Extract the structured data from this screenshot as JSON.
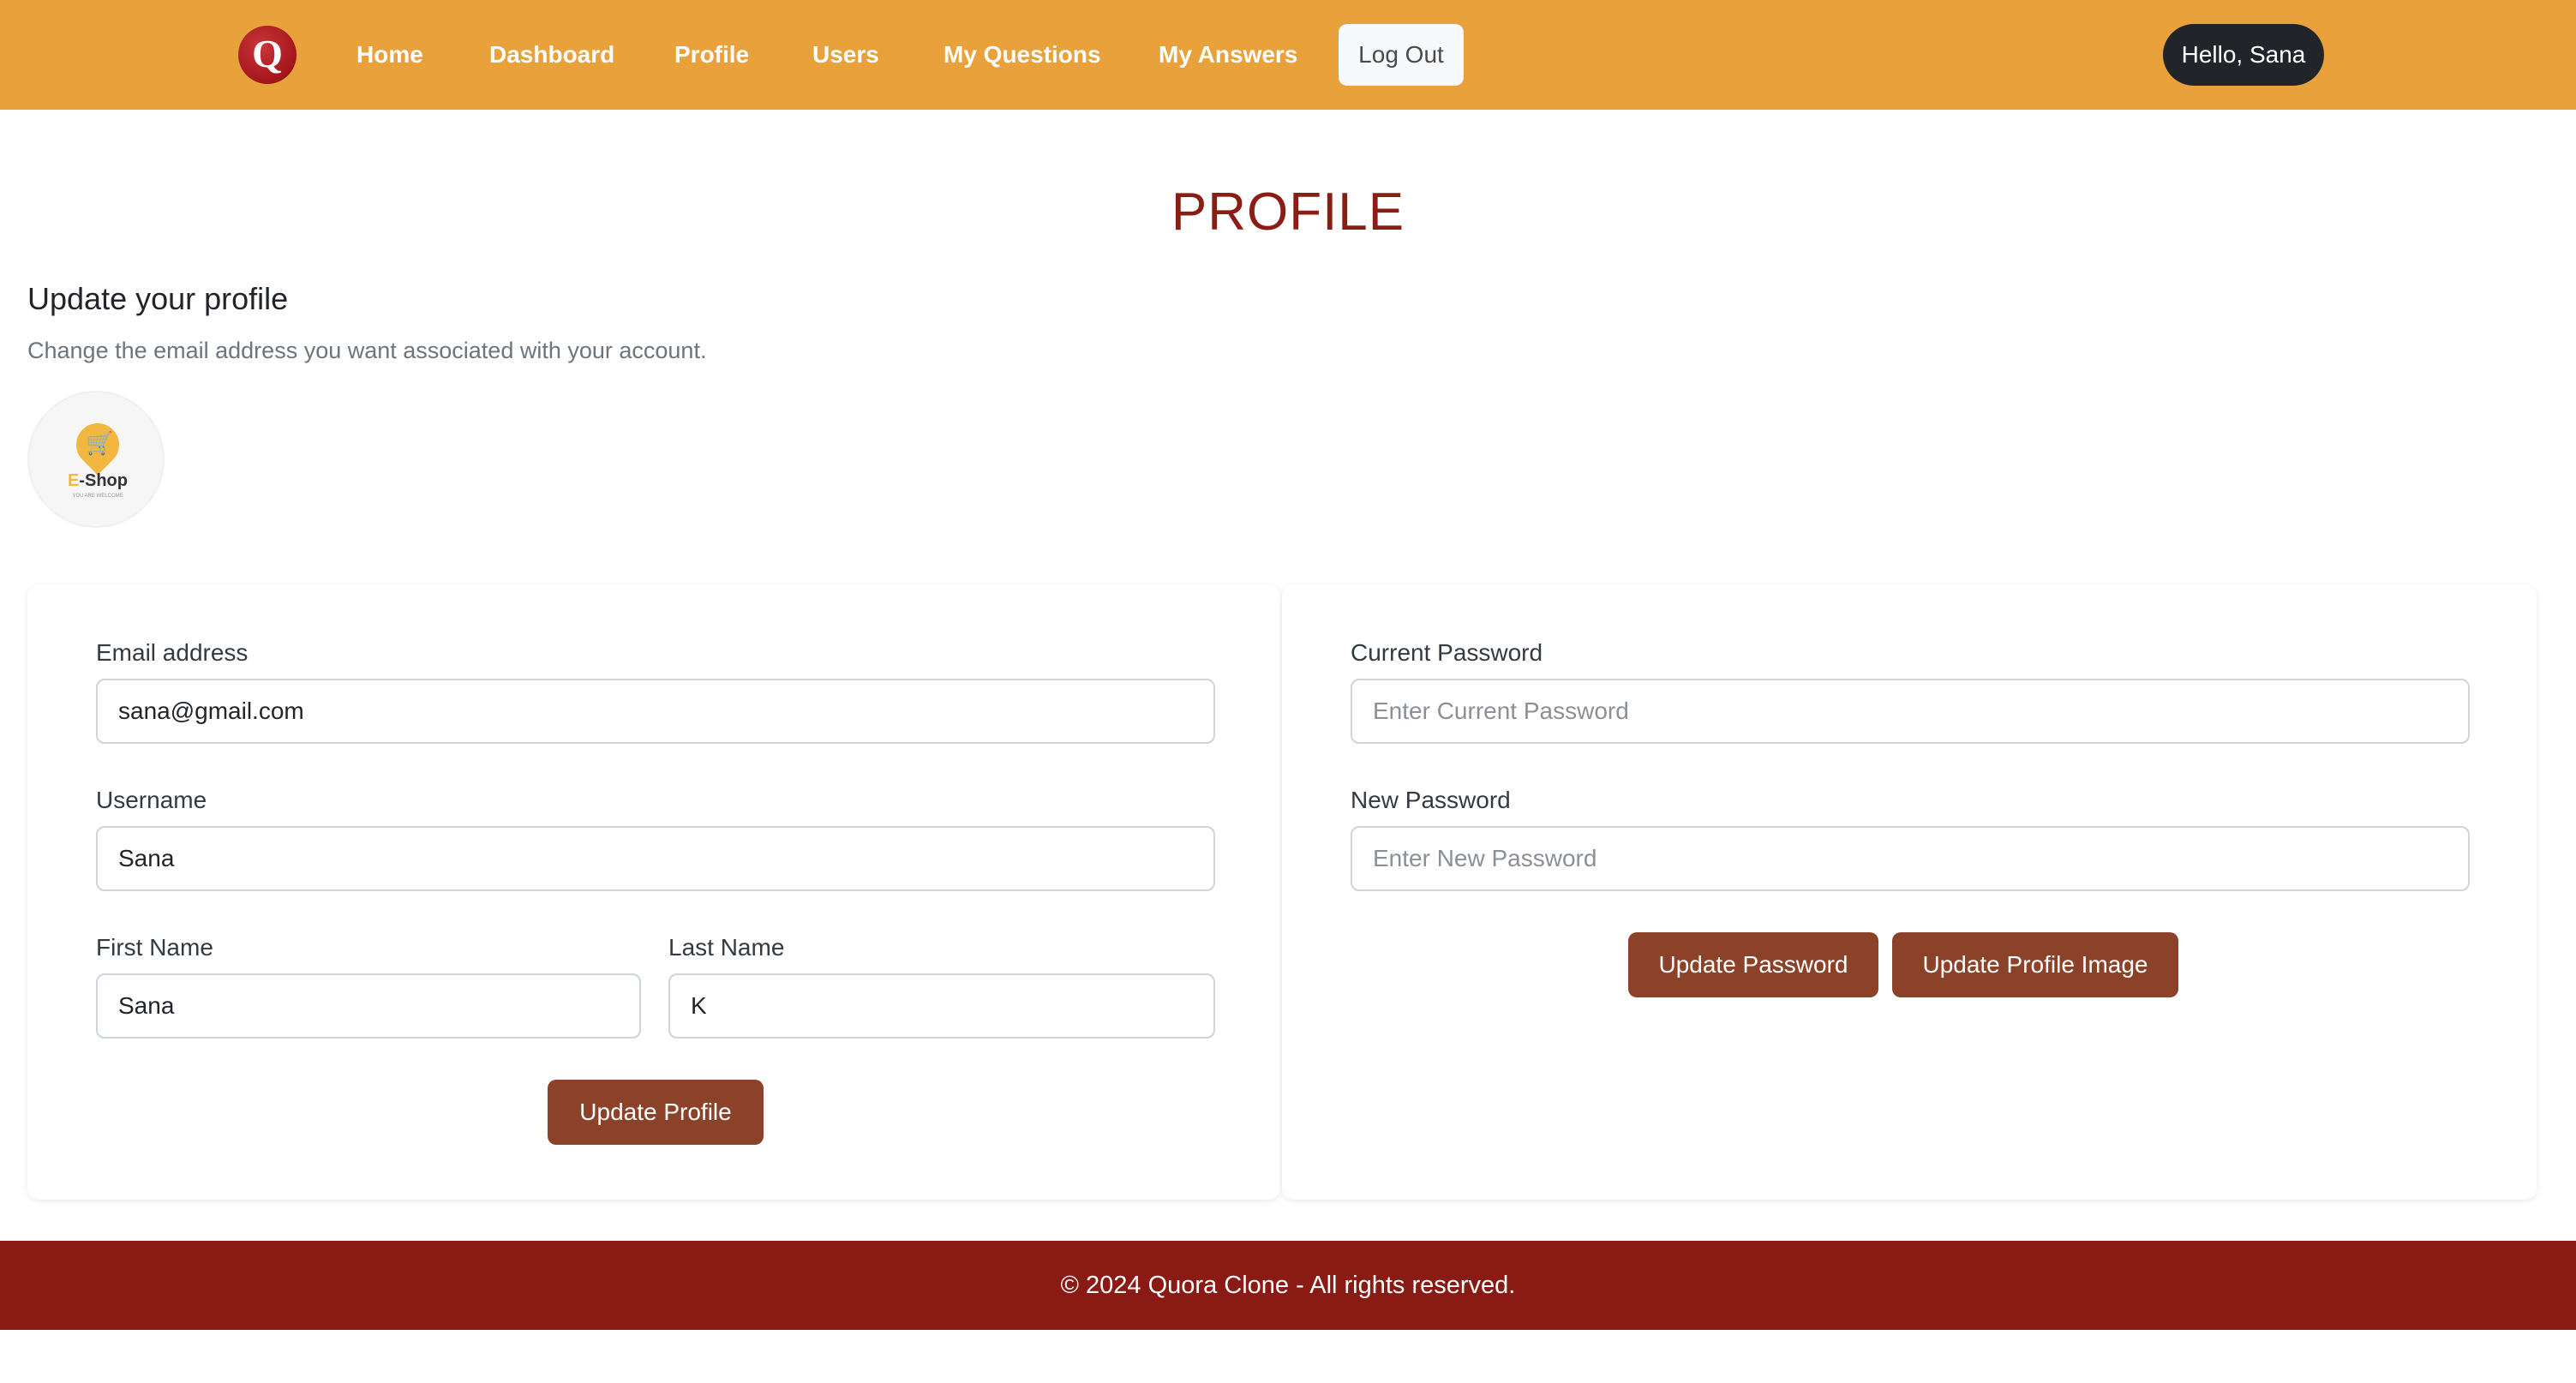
{
  "nav": {
    "logo_letter": "Q",
    "links": [
      "Home",
      "Dashboard",
      "Profile",
      "Users",
      "My Questions",
      "My Answers"
    ],
    "logout": "Log Out",
    "greeting": "Hello, Sana"
  },
  "page": {
    "title": "PROFILE",
    "heading": "Update your profile",
    "subheading": "Change the email address you want associated with your account."
  },
  "avatar": {
    "brand_e": "E",
    "brand_rest": "-Shop",
    "tagline": "YOU ARE WELCOME"
  },
  "profile_form": {
    "email_label": "Email address",
    "email_value": "sana@gmail.com",
    "username_label": "Username",
    "username_value": "Sana",
    "first_name_label": "First Name",
    "first_name_value": "Sana",
    "last_name_label": "Last Name",
    "last_name_value": "K",
    "submit": "Update Profile"
  },
  "password_form": {
    "current_label": "Current Password",
    "current_placeholder": "Enter Current Password",
    "new_label": "New Password",
    "new_placeholder": "Enter New Password",
    "update_password": "Update Password",
    "update_image": "Update Profile Image"
  },
  "footer": {
    "text": "© 2024 Quora Clone - All rights reserved."
  },
  "colors": {
    "navbar": "#e9a23b",
    "title": "#8b1e14",
    "button": "#8b4229",
    "footer": "#891a14",
    "greeting_pill": "#212529"
  }
}
